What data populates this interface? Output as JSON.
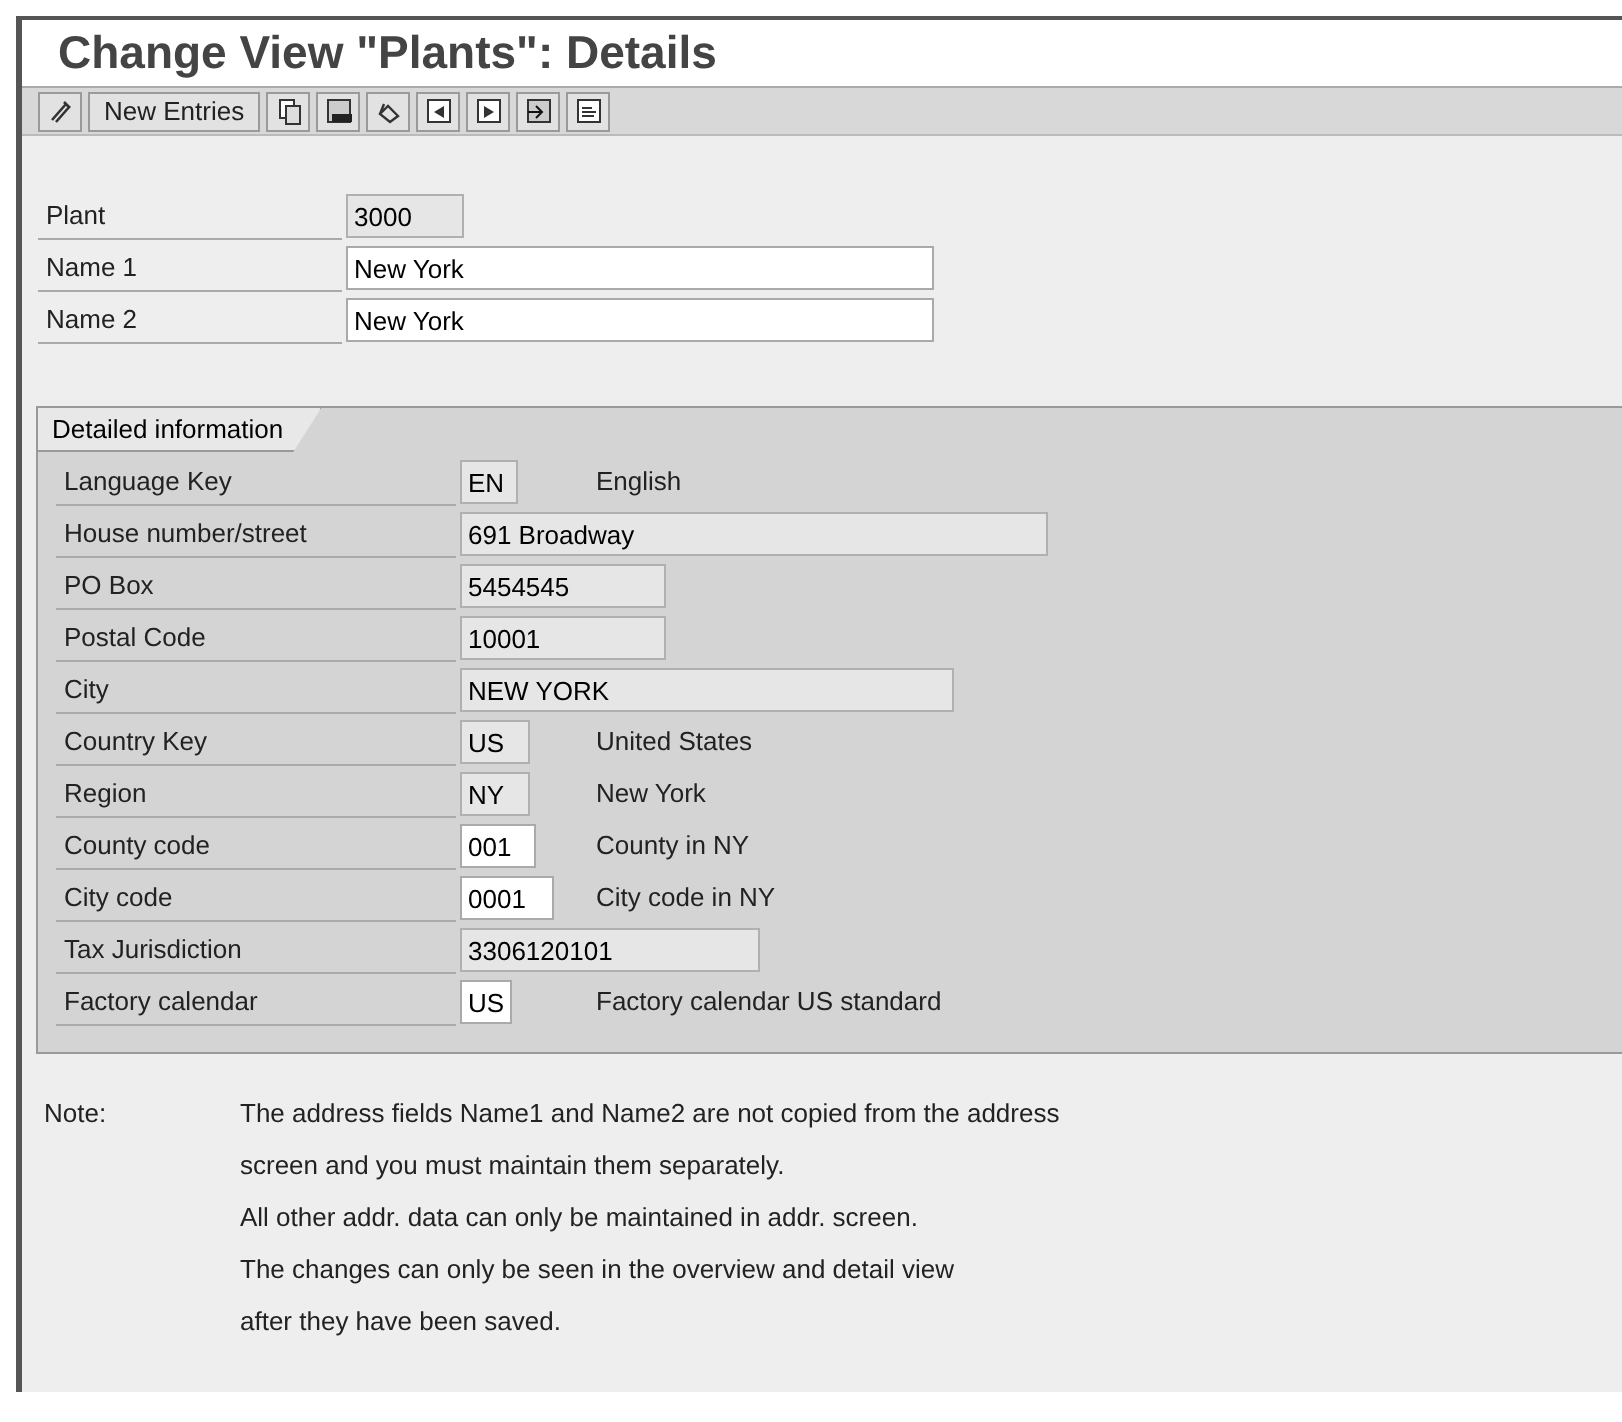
{
  "window": {
    "title": "Change View \"Plants\": Details"
  },
  "toolbar": [
    {
      "kind": "icon"
    },
    {
      "kind": "text",
      "label": "New Entries"
    },
    {
      "kind": "icon"
    },
    {
      "kind": "icon"
    },
    {
      "kind": "icon"
    },
    {
      "kind": "icon"
    },
    {
      "kind": "icon"
    },
    {
      "kind": "icon"
    },
    {
      "kind": "icon"
    }
  ],
  "header_fields": [
    {
      "label": "Plant",
      "value": "3000",
      "editable": false
    },
    {
      "label": "Name 1",
      "value": "New York",
      "editable": true
    },
    {
      "label": "Name 2",
      "value": "New York",
      "editable": true
    }
  ],
  "group": {
    "title": "Detailed information",
    "fields": [
      {
        "label": "Language Key",
        "value": "EN",
        "editable": false,
        "description": "English"
      },
      {
        "label": "House number/street",
        "value": "691 Broadway",
        "editable": false
      },
      {
        "label": "PO Box",
        "value": "5454545",
        "editable": false
      },
      {
        "label": "Postal Code",
        "value": "10001",
        "editable": false
      },
      {
        "label": "City",
        "value": "NEW YORK",
        "editable": false
      },
      {
        "label": "Country Key",
        "value": "US",
        "editable": false,
        "description": "United States"
      },
      {
        "label": "Region",
        "value": "NY",
        "editable": false,
        "description": "New York"
      },
      {
        "label": "County code",
        "value": "001",
        "editable": true,
        "description": "County in NY"
      },
      {
        "label": "City code",
        "value": "0001",
        "editable": true,
        "description": "City code in NY"
      },
      {
        "label": "Tax Jurisdiction",
        "value": "3306120101",
        "editable": false
      },
      {
        "label": "Factory calendar",
        "value": "US",
        "editable": true,
        "description": "Factory calendar US standard"
      }
    ]
  },
  "note": {
    "label": "Note:",
    "lines": [
      "The address fields Name1 and Name2 are not copied from the address",
      "screen and you must maintain them separately.",
      "All other addr. data can only be maintained in addr. screen.",
      "The changes can only be seen in the overview and detail view",
      "after they have been saved."
    ]
  }
}
